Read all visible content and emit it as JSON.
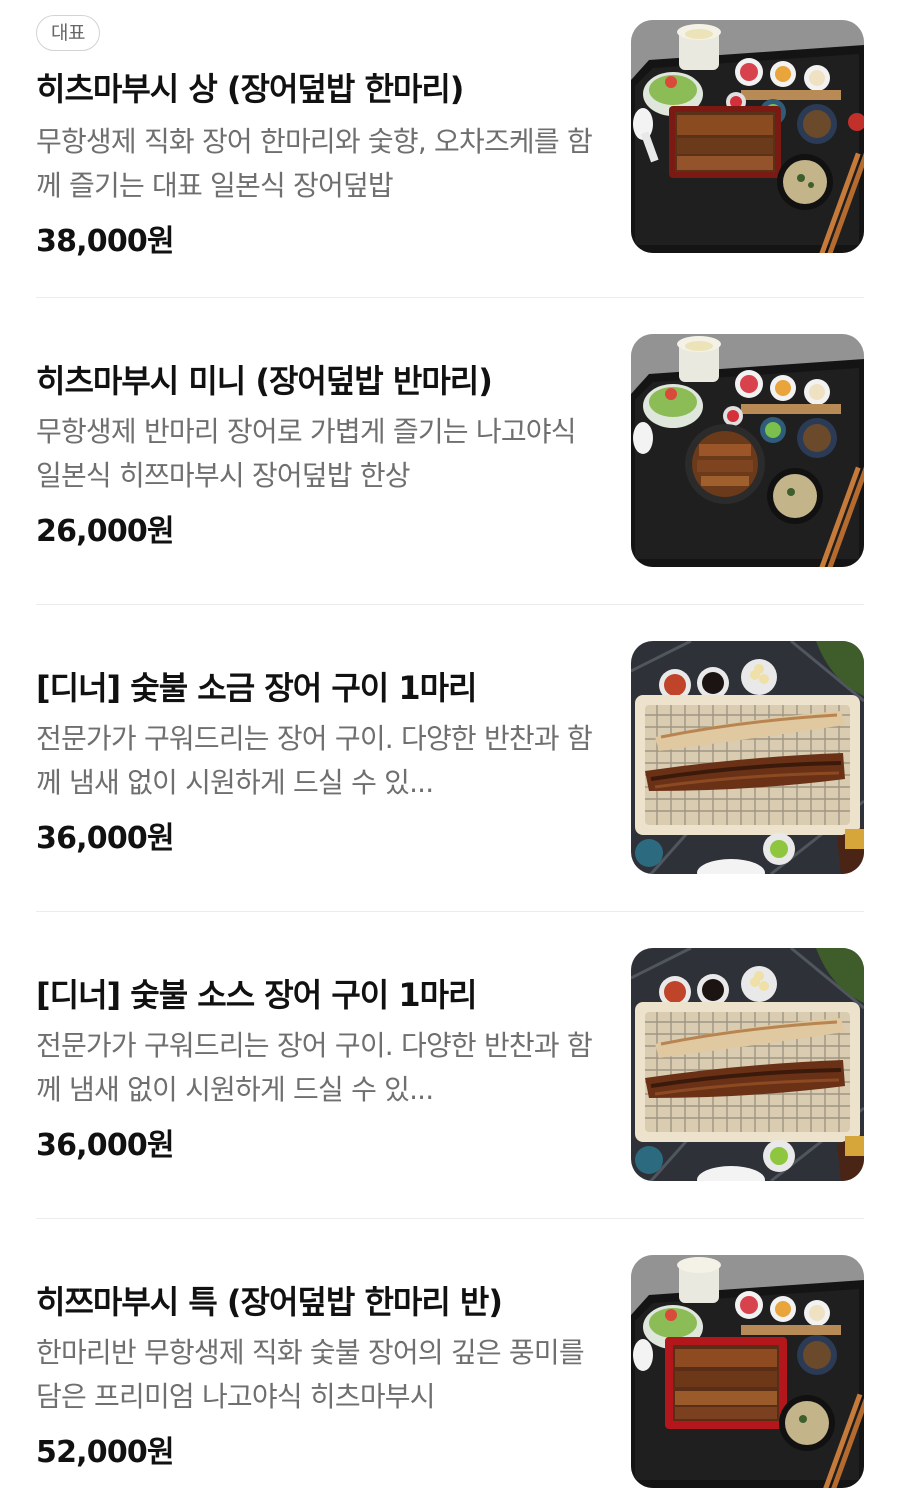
{
  "items": [
    {
      "badge": "대표",
      "name": "히츠마부시 상 (장어덮밥 한마리)",
      "desc": "무항생제 직화 장어 한마리와 숯향, 오차즈케를 함께 즐기는 대표 일본식 장어덮밥",
      "price": "38,000원",
      "image": "eel-rice-set-photo"
    },
    {
      "name": "히츠마부시 미니 (장어덮밥 반마리)",
      "desc": "무항생제 반마리 장어로 가볍게 즐기는 나고야식 일본식 히쯔마부시 장어덮밥 한상",
      "price": "26,000원",
      "image": "eel-rice-mini-set-photo"
    },
    {
      "name": "[디너] 숯불 소금 장어 구이 1마리",
      "desc": "전문가가 구워드리는 장어 구이. 다양한 반찬과 함께 냄새 없이 시원하게 드실 수 있...",
      "price": "36,000원",
      "image": "grilled-eel-salt-photo"
    },
    {
      "name": "[디너] 숯불 소스 장어 구이 1마리",
      "desc": "전문가가 구워드리는 장어 구이. 다양한 반찬과 함께 냄새 없이 시원하게 드실 수 있...",
      "price": "36,000원",
      "image": "grilled-eel-sauce-photo"
    },
    {
      "name": "히쯔마부시 특 (장어덮밥 한마리 반)",
      "desc": "한마리반 무항생제 직화 숯불 장어의 깊은 풍미를 담은 프리미엄 나고야식 히츠마부시",
      "price": "52,000원",
      "image": "eel-rice-premium-set-photo"
    }
  ],
  "colors": {
    "title": "#111111",
    "description": "#6f6f6f",
    "badge_border": "#d3d3d3",
    "divider": "#ececec"
  }
}
